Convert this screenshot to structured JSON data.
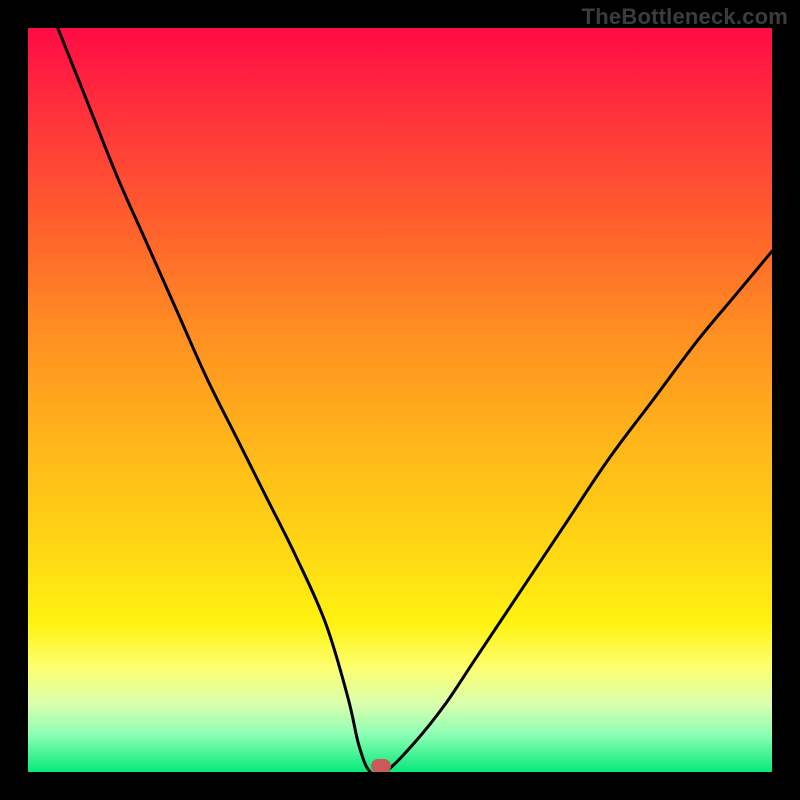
{
  "watermark": "TheBottleneck.com",
  "chart_data": {
    "type": "line",
    "title": "",
    "xlabel": "",
    "ylabel": "",
    "xlim": [
      0,
      1
    ],
    "ylim": [
      0,
      1
    ],
    "grid": false,
    "legend": false,
    "series": [
      {
        "name": "bottleneck-curve",
        "x": [
          0.0,
          0.04,
          0.08,
          0.12,
          0.16,
          0.2,
          0.24,
          0.28,
          0.32,
          0.36,
          0.4,
          0.43,
          0.445,
          0.46,
          0.48,
          0.52,
          0.56,
          0.6,
          0.66,
          0.72,
          0.78,
          0.84,
          0.9,
          0.95,
          1.0
        ],
        "values": [
          1.1,
          1.0,
          0.9,
          0.8,
          0.71,
          0.62,
          0.53,
          0.45,
          0.37,
          0.29,
          0.2,
          0.1,
          0.035,
          0.0,
          0.0,
          0.04,
          0.09,
          0.15,
          0.24,
          0.33,
          0.42,
          0.5,
          0.58,
          0.64,
          0.7
        ]
      }
    ],
    "marker": {
      "x": 0.475,
      "y": 0.0
    },
    "gradient_stops": [
      {
        "pos": 0.0,
        "color": "#ff0b45"
      },
      {
        "pos": 0.25,
        "color": "#ff5b2e"
      },
      {
        "pos": 0.55,
        "color": "#ffb41a"
      },
      {
        "pos": 0.8,
        "color": "#fff310"
      },
      {
        "pos": 1.0,
        "color": "#06e97a"
      }
    ]
  }
}
